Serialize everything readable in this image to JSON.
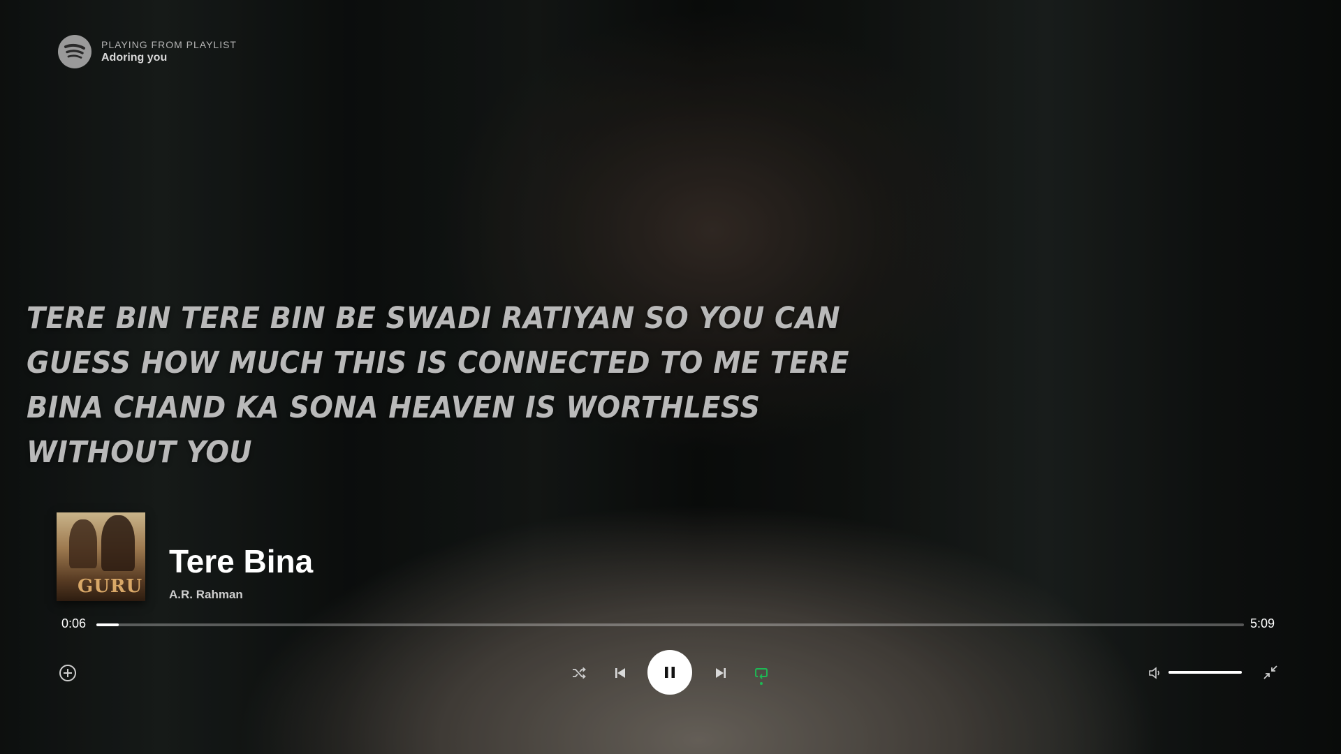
{
  "header": {
    "kicker": "PLAYING FROM PLAYLIST",
    "playlist": "Adoring you"
  },
  "lyrics": {
    "text": "Tere bin tere bin be swadi ratiyan so you can guess how much this is connected to me Tere bina chand ka sona heaven is worthless without you"
  },
  "now_playing": {
    "title": "Tere Bina",
    "artist": "A.R. Rahman",
    "album_art_text": "GURU"
  },
  "progress": {
    "elapsed": "0:06",
    "total": "5:09",
    "fraction": 0.0194
  },
  "volume": {
    "level": 1.0
  },
  "icons": {
    "logo": "spotify-logo-icon",
    "add": "add-circle-icon",
    "shuffle": "shuffle-icon",
    "previous": "skip-previous-icon",
    "pause": "pause-icon",
    "next": "skip-next-icon",
    "repeat": "repeat-icon",
    "volume": "volume-icon",
    "fullscreen": "exit-fullscreen-icon"
  },
  "colors": {
    "accent": "#1db954",
    "text": "#ffffff",
    "muted": "#b3b3b3"
  }
}
